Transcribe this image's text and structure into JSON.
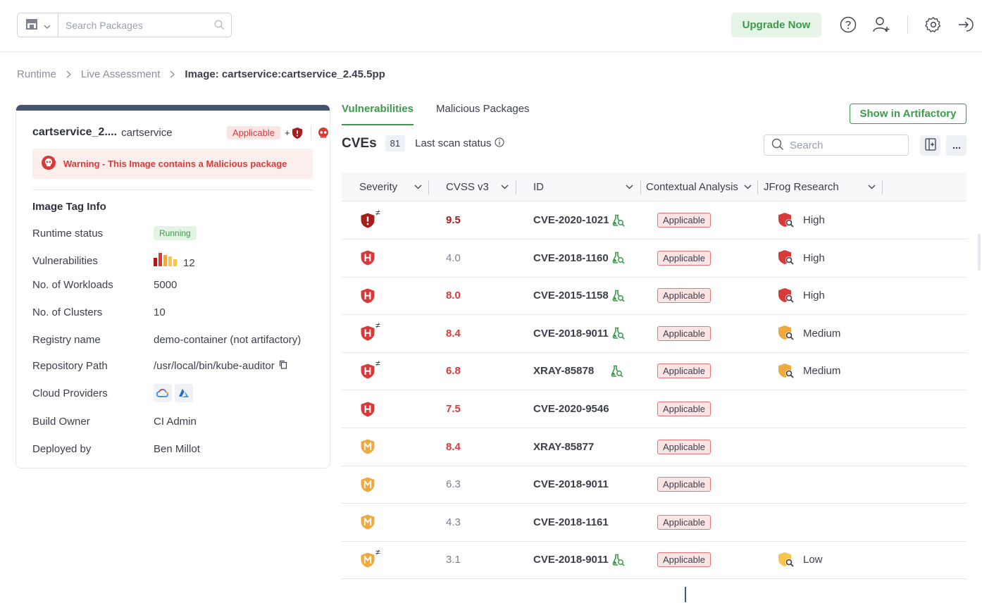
{
  "topbar": {
    "search_placeholder": "Search Packages",
    "upgrade_label": "Upgrade Now",
    "icons": [
      "help-icon",
      "add-user-icon",
      "settings-icon",
      "logout-icon"
    ]
  },
  "breadcrumb": {
    "items": [
      "Runtime",
      "Live Assessment"
    ],
    "current": "Image: cartservice:cartservice_2.45.5pp"
  },
  "card": {
    "title": "cartservice_2....",
    "subtitle": "cartservice",
    "applicable_label": "Applicable",
    "plus": "+",
    "warning": "Warning - This Image contains a Malicious package",
    "section_title": "Image Tag Info",
    "rows": [
      {
        "label": "Runtime status",
        "value": "Running"
      },
      {
        "label": "Vulnerabilities",
        "value": "12"
      },
      {
        "label": "No. of Workloads",
        "value": "5000"
      },
      {
        "label": "No. of Clusters",
        "value": "10"
      },
      {
        "label": "Registry name",
        "value": "demo-container (not artifactory)"
      },
      {
        "label": "Repository Path",
        "value": "/usr/local/bin/kube-auditor"
      },
      {
        "label": "Cloud Providers",
        "value": ""
      },
      {
        "label": "Build Owner",
        "value": "CI Admin"
      },
      {
        "label": "Deployed by",
        "value": "Ben Millot"
      }
    ],
    "vuln_bar_colors": [
      "#a81c1c",
      "#d83a3a",
      "#f0a93c",
      "#f6c54a",
      "#f6c54a"
    ]
  },
  "tabs": [
    "Vulnerabilities",
    "Malicious Packages"
  ],
  "artifactory_label": "Show in Artifactory",
  "cves": {
    "title": "CVEs",
    "count": "81",
    "scan_status": "Last scan status",
    "search_placeholder": "Search"
  },
  "table": {
    "headers": [
      "Severity",
      "CVSS v3",
      "ID",
      "Contextual Analysis",
      "JFrog Research"
    ],
    "rows": [
      {
        "sev": "critical",
        "ne": true,
        "cvss": "9.5",
        "cvss_style": "dark",
        "id": "CVE-2020-1021",
        "flask": true,
        "applicable": "Applicable",
        "research": "High",
        "research_level": "high"
      },
      {
        "sev": "high",
        "ne": false,
        "cvss": "4.0",
        "cvss_style": "gray",
        "id": "CVE-2018-1160",
        "flask": true,
        "applicable": "Applicable",
        "research": "High",
        "research_level": "high"
      },
      {
        "sev": "high",
        "ne": false,
        "cvss": "8.0",
        "cvss_style": "red",
        "id": "CVE-2015-1158",
        "flask": true,
        "applicable": "Applicable",
        "research": "High",
        "research_level": "high"
      },
      {
        "sev": "high",
        "ne": true,
        "cvss": "8.4",
        "cvss_style": "red",
        "id": "CVE-2018-9011",
        "flask": true,
        "applicable": "Applicable",
        "research": "Medium",
        "research_level": "medium"
      },
      {
        "sev": "high",
        "ne": true,
        "cvss": "6.8",
        "cvss_style": "red",
        "id": "XRAY-85878",
        "flask": true,
        "applicable": "Applicable",
        "research": "Medium",
        "research_level": "medium"
      },
      {
        "sev": "high",
        "ne": false,
        "cvss": "7.5",
        "cvss_style": "red",
        "id": "CVE-2020-9546",
        "flask": false,
        "applicable": "Applicable",
        "research": "",
        "research_level": ""
      },
      {
        "sev": "medium",
        "ne": false,
        "cvss": "8.4",
        "cvss_style": "red",
        "id": "XRAY-85877",
        "flask": false,
        "applicable": "Applicable",
        "research": "",
        "research_level": ""
      },
      {
        "sev": "medium",
        "ne": false,
        "cvss": "6.3",
        "cvss_style": "gray",
        "id": "CVE-2018-9011",
        "flask": false,
        "applicable": "Applicable",
        "research": "",
        "research_level": ""
      },
      {
        "sev": "medium",
        "ne": false,
        "cvss": "4.3",
        "cvss_style": "gray",
        "id": "CVE-2018-1161",
        "flask": false,
        "applicable": "Applicable",
        "research": "",
        "research_level": ""
      },
      {
        "sev": "medium",
        "ne": true,
        "cvss": "3.1",
        "cvss_style": "gray",
        "id": "CVE-2018-9011",
        "flask": true,
        "applicable": "Applicable",
        "research": "Low",
        "research_level": "low"
      }
    ]
  },
  "colors": {
    "accent": "#3d9a4b",
    "critical": "#a81c1c",
    "high": "#d83a3a",
    "medium": "#f0a93c",
    "low": "#f6c54a"
  }
}
